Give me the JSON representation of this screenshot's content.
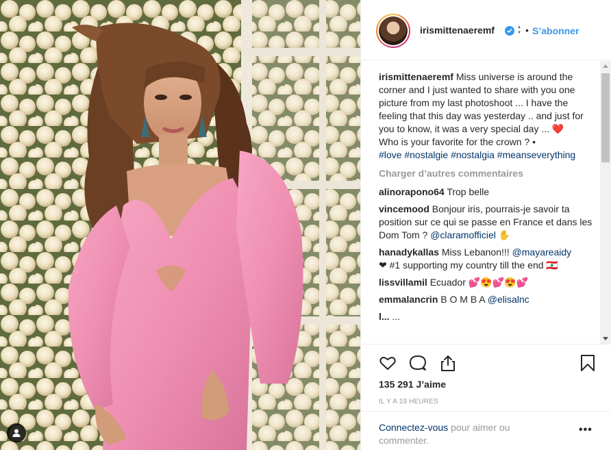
{
  "post": {
    "username": "irismittenaeremf",
    "follow_label": "S’abonner",
    "separator": "•"
  },
  "caption": {
    "username": "irismittenaeremf",
    "text": "Miss universe is around the corner and I just wanted to share with you one picture from my last photoshoot ... I have the feeling that this day was yesterday .. and just for you to know, it was a very special day ... ❤️",
    "text2": "Who is your favorite for the crown ? •",
    "hashtags": "#love #nostalgie #nostalgia #meanseverything"
  },
  "load_more": "Charger d’autres commentaires",
  "comments": [
    {
      "user": "alinorapono64",
      "text": "Trop belle",
      "mention": ""
    },
    {
      "user": "vincemood",
      "text": "Bonjour iris, pourrais-je savoir ta position sur ce qui se passe en France et dans les Dom Tom ?",
      "mention": "@claramofficiel ✋"
    },
    {
      "user": "hanadykallas",
      "text": "Miss Lebanon!!!",
      "mention": "@mayareaidy",
      "extra": "❤ #1 supporting my country till the end 🇱🇧"
    },
    {
      "user": "lissvillamil",
      "text": "Ecuador 💕😍💕😍💕",
      "mention": ""
    },
    {
      "user": "emmalancrin",
      "text": "B O M B A",
      "mention": "@elisalnc"
    },
    {
      "user": "l...",
      "text": "...",
      "mention": ""
    }
  ],
  "likes": "135 291 J’aime",
  "timestamp": "IL Y A 19 HEURES",
  "login": {
    "link": "Connectez-vous",
    "rest": "pour aimer ou commenter."
  },
  "more_label": "•••",
  "colors": {
    "accent": "#3897f0",
    "link": "#003569",
    "muted": "#999999",
    "dress": "#f08fb2"
  },
  "icons": [
    "heart-icon",
    "comment-icon",
    "share-icon",
    "bookmark-icon",
    "user-tag-icon",
    "verified-icon"
  ]
}
